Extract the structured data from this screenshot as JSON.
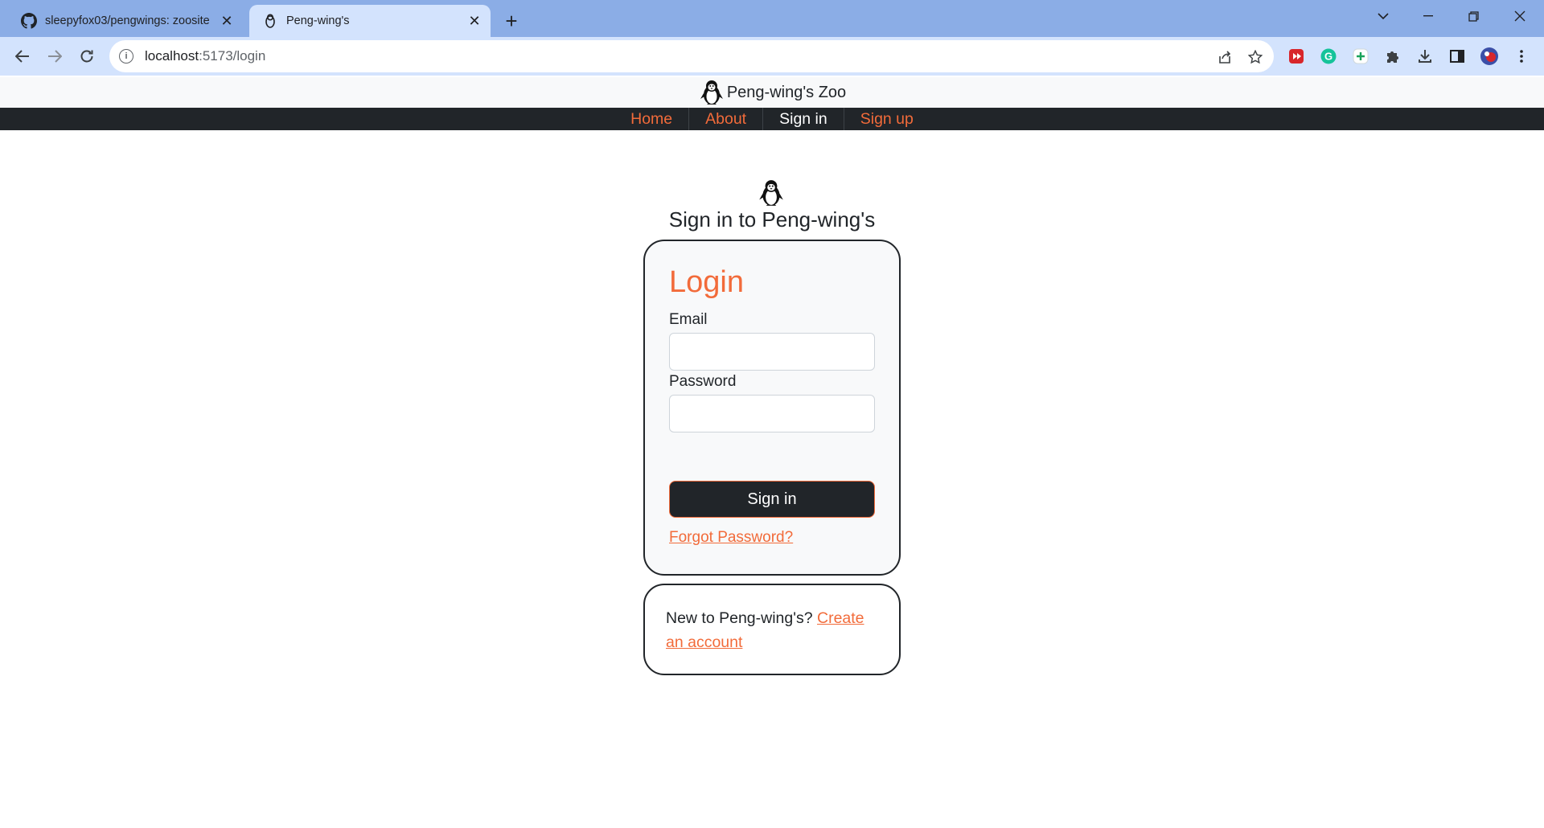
{
  "browser": {
    "tabs": [
      {
        "title": "sleepyfox03/pengwings: zoosite",
        "favicon": "github-icon",
        "active": false
      },
      {
        "title": "Peng-wing's",
        "favicon": "penguin-icon",
        "active": true
      }
    ],
    "url_host": "localhost",
    "url_path": ":5173/login"
  },
  "site": {
    "brand": "Peng-wing's Zoo",
    "accent_color": "#f26b3a",
    "nav": [
      {
        "label": "Home",
        "current": false
      },
      {
        "label": "About",
        "current": false
      },
      {
        "label": "Sign in",
        "current": true
      },
      {
        "label": "Sign up",
        "current": false
      }
    ]
  },
  "signin": {
    "heading": "Sign in to Peng-wing's",
    "card_title": "Login",
    "email_label": "Email",
    "email_value": "",
    "password_label": "Password",
    "password_value": "",
    "submit_label": "Sign in",
    "forgot_link": "Forgot Password?"
  },
  "signup": {
    "prompt": "New to Peng-wing's?",
    "link": "Create an account"
  }
}
